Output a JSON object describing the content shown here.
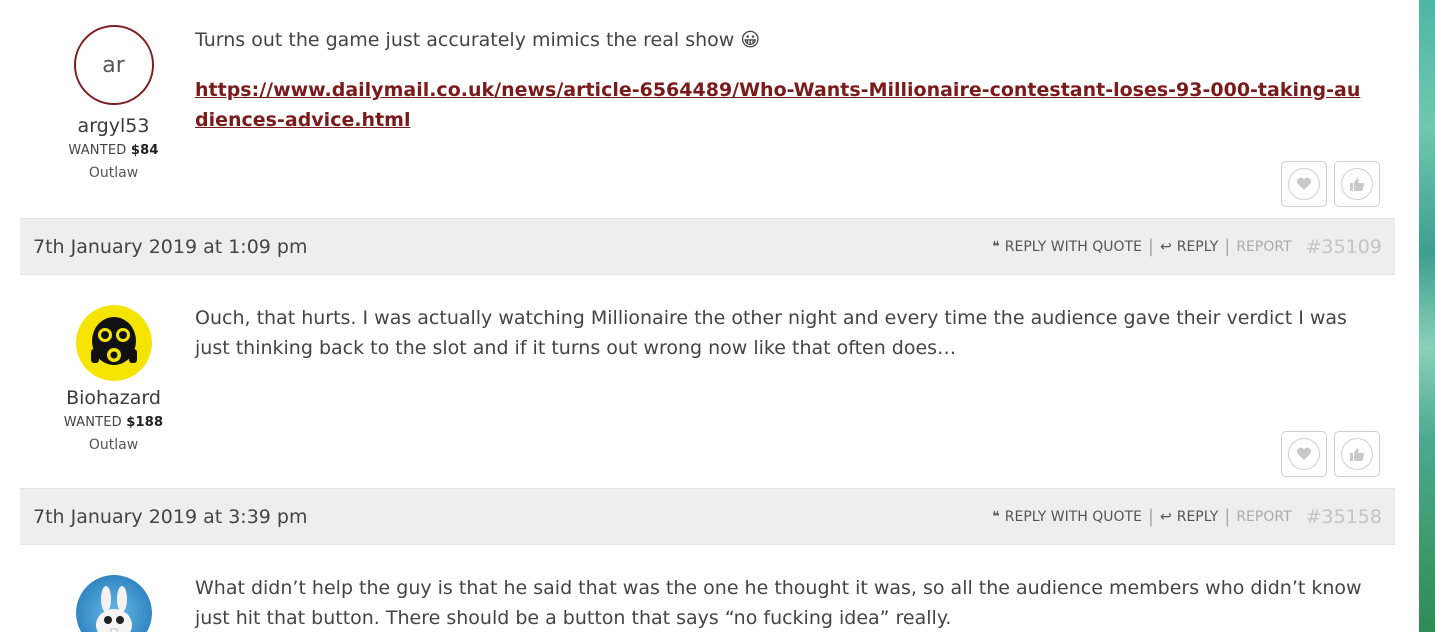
{
  "posts": [
    {
      "author": {
        "initials": "ar",
        "name": "argyl53",
        "wanted_label": "WANTED",
        "bounty": "$84",
        "rank": "Outlaw"
      },
      "text": "Turns out the game just accurately mimics the real show",
      "emoji": "😀",
      "link": "https://www.dailymail.co.uk/news/article-6564489/Who-Wants-Millionaire-contestant-loses-93-000-taking-audiences-advice.html"
    },
    {
      "meta": {
        "date": "7th January 2019 at 1:09 pm",
        "number": "#35109"
      },
      "author": {
        "name": "Biohazard",
        "wanted_label": "WANTED",
        "bounty": "$188",
        "rank": "Outlaw",
        "avatar_icon": "gas-mask-avatar"
      },
      "text": "Ouch, that hurts. I was actually watching Millionaire the other night and every time the audience gave their verdict I was just thinking back to the slot and if it turns out wrong now like that often does…"
    },
    {
      "meta": {
        "date": "7th January 2019 at 3:39 pm",
        "number": "#35158"
      },
      "author": {
        "avatar_icon": "rabbit-avatar"
      },
      "text": "What didn’t help the guy is that he said that was the one he thought it was, so all the audience members who didn’t know just hit that button. There should be a button that says “no fucking idea” really."
    }
  ],
  "labels": {
    "reply_with_quote": "REPLY WITH QUOTE",
    "reply": "REPLY",
    "report": "REPORT"
  },
  "colors": {
    "accent": "#7b1a1a",
    "meta_bg": "#eeeeee"
  }
}
